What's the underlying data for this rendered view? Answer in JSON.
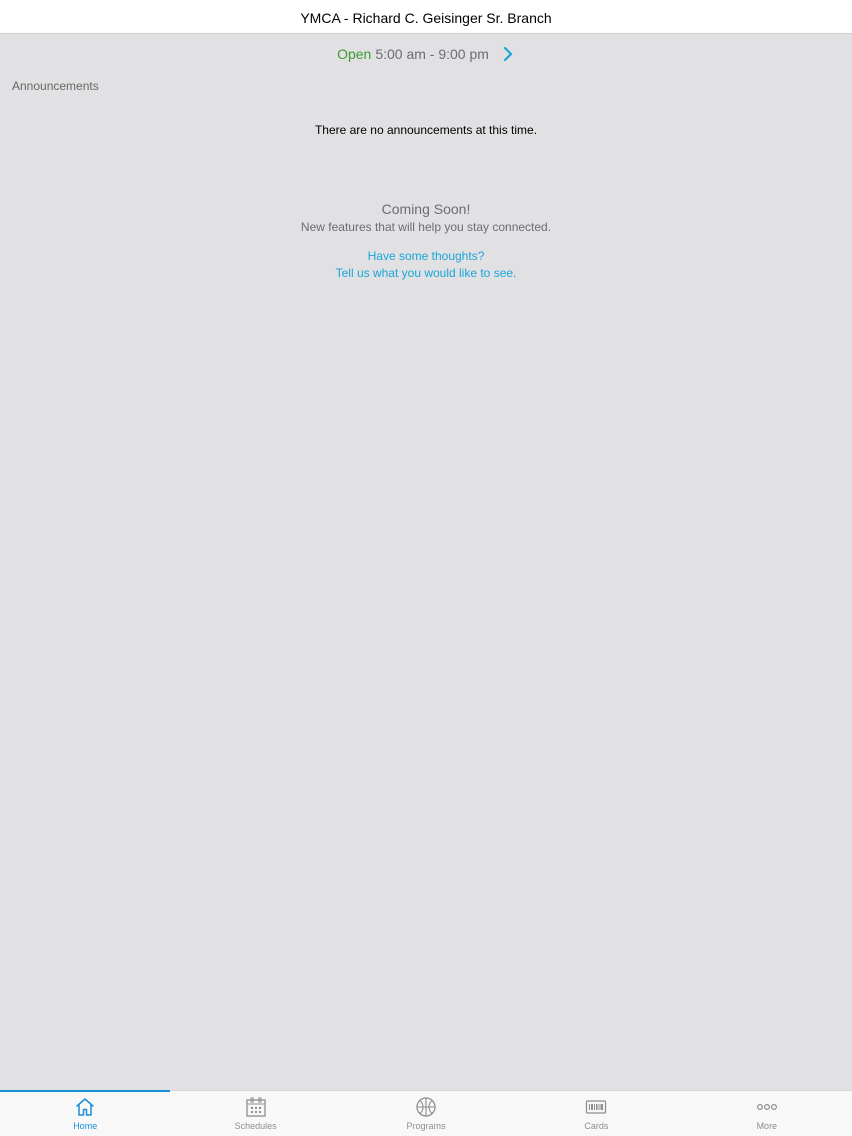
{
  "header": {
    "title": "YMCA - Richard C. Geisinger Sr. Branch"
  },
  "hours": {
    "status": "Open",
    "range": "5:00 am - 9:00 pm"
  },
  "announcements": {
    "label": "Announcements",
    "empty_message": "There are no announcements at this time."
  },
  "coming_soon": {
    "title": "Coming Soon!",
    "subtitle": "New features that will help you stay connected.",
    "feedback_line1": "Have some thoughts?",
    "feedback_line2": "Tell us what you would like to see."
  },
  "tabs": [
    {
      "label": "Home",
      "icon": "home-icon",
      "active": true
    },
    {
      "label": "Schedules",
      "icon": "calendar-icon",
      "active": false
    },
    {
      "label": "Programs",
      "icon": "basketball-icon",
      "active": false
    },
    {
      "label": "Cards",
      "icon": "barcode-card-icon",
      "active": false
    },
    {
      "label": "More",
      "icon": "more-dots-icon",
      "active": false
    }
  ],
  "colors": {
    "accent": "#1b8fd6",
    "link": "#1aa6d9",
    "open_status": "#3f9a34",
    "background": "#e1e0e3"
  }
}
